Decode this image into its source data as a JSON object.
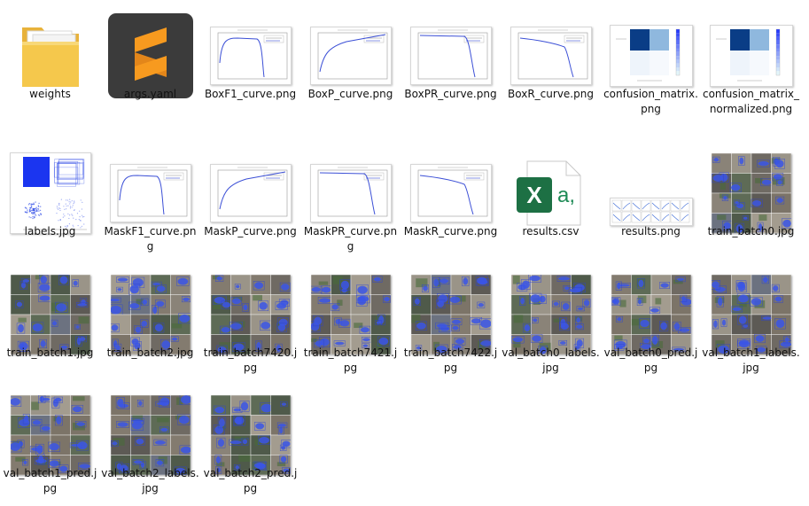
{
  "files": [
    {
      "name": "weights",
      "kind": "folder"
    },
    {
      "name": "args.yaml",
      "kind": "yaml"
    },
    {
      "name": "BoxF1_curve.png",
      "kind": "curve-f1"
    },
    {
      "name": "BoxP_curve.png",
      "kind": "curve-p"
    },
    {
      "name": "BoxPR_curve.png",
      "kind": "curve-pr"
    },
    {
      "name": "BoxR_curve.png",
      "kind": "curve-r"
    },
    {
      "name": "confusion_matrix.png",
      "kind": "confusion"
    },
    {
      "name": "confusion_matrix_normalized.png",
      "kind": "confusion"
    },
    {
      "name": "labels.jpg",
      "kind": "labels"
    },
    {
      "name": "MaskF1_curve.png",
      "kind": "curve-f1"
    },
    {
      "name": "MaskP_curve.png",
      "kind": "curve-p"
    },
    {
      "name": "MaskPR_curve.png",
      "kind": "curve-pr"
    },
    {
      "name": "MaskR_curve.png",
      "kind": "curve-r"
    },
    {
      "name": "results.csv",
      "kind": "csv"
    },
    {
      "name": "results.png",
      "kind": "results"
    },
    {
      "name": "train_batch0.jpg",
      "kind": "batch"
    },
    {
      "name": "train_batch1.jpg",
      "kind": "batch"
    },
    {
      "name": "train_batch2.jpg",
      "kind": "batch"
    },
    {
      "name": "train_batch7420.jpg",
      "kind": "batch"
    },
    {
      "name": "train_batch7421.jpg",
      "kind": "batch"
    },
    {
      "name": "train_batch7422.jpg",
      "kind": "batch"
    },
    {
      "name": "val_batch0_labels.jpg",
      "kind": "batch"
    },
    {
      "name": "val_batch0_pred.jpg",
      "kind": "batch"
    },
    {
      "name": "val_batch1_labels.jpg",
      "kind": "batch"
    },
    {
      "name": "val_batch1_pred.jpg",
      "kind": "batch"
    },
    {
      "name": "val_batch2_labels.jpg",
      "kind": "batch"
    },
    {
      "name": "val_batch2_pred.jpg",
      "kind": "batch"
    }
  ],
  "colors": {
    "mask_blue": "#3a55e8",
    "curve_blue": "#3b4fd6",
    "folder_yellow": "#f5c84c",
    "sublime_orange": "#f79a1f",
    "excel_green": "#1d7044"
  }
}
